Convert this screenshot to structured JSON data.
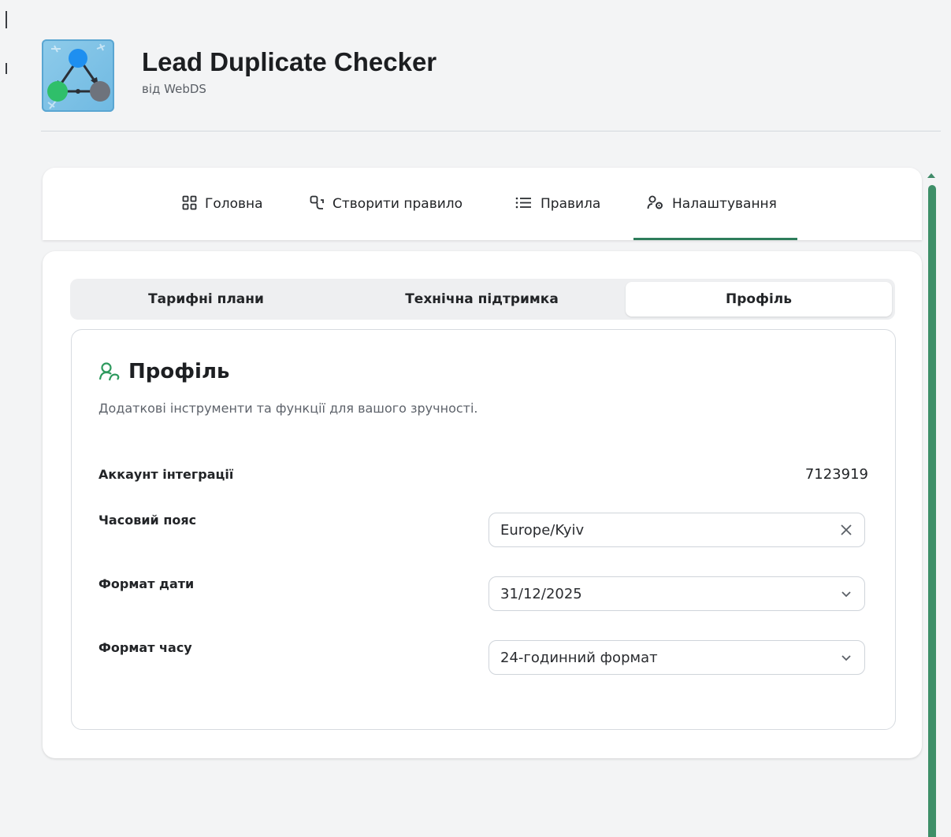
{
  "app": {
    "title": "Lead Duplicate Checker",
    "vendor": "від WebDS",
    "logo_icon": "network-triangle-icon"
  },
  "nav": {
    "active_index": 3,
    "accent_color": "#2e7d5b",
    "tabs": [
      {
        "label": "Головна",
        "icon": "dashboard-grid-icon"
      },
      {
        "label": "Створити правило",
        "icon": "create-rule-icon"
      },
      {
        "label": "Правила",
        "icon": "list-icon"
      },
      {
        "label": "Налаштування",
        "icon": "user-settings-icon"
      }
    ]
  },
  "subtabs": {
    "active_index": 2,
    "items": [
      {
        "label": "Тарифні плани"
      },
      {
        "label": "Технічна підтримка"
      },
      {
        "label": "Профіль"
      }
    ]
  },
  "profile": {
    "title": "Профіль",
    "title_icon": "users-icon",
    "description": "Додаткові інструменти та функції для вашого зручності.",
    "account": {
      "label": "Аккаунт інтеграції",
      "value": "7123919"
    },
    "timezone": {
      "label": "Часовий пояс",
      "value": "Europe/Kyiv",
      "action_icon": "clear-icon"
    },
    "date_format": {
      "label": "Формат дати",
      "value": "31/12/2025",
      "action_icon": "chevron-down-icon"
    },
    "time_format": {
      "label": "Формат часу",
      "value": "24-годинний формат",
      "action_icon": "chevron-down-icon"
    }
  },
  "scrollbar": {
    "color": "#3e8f68"
  }
}
